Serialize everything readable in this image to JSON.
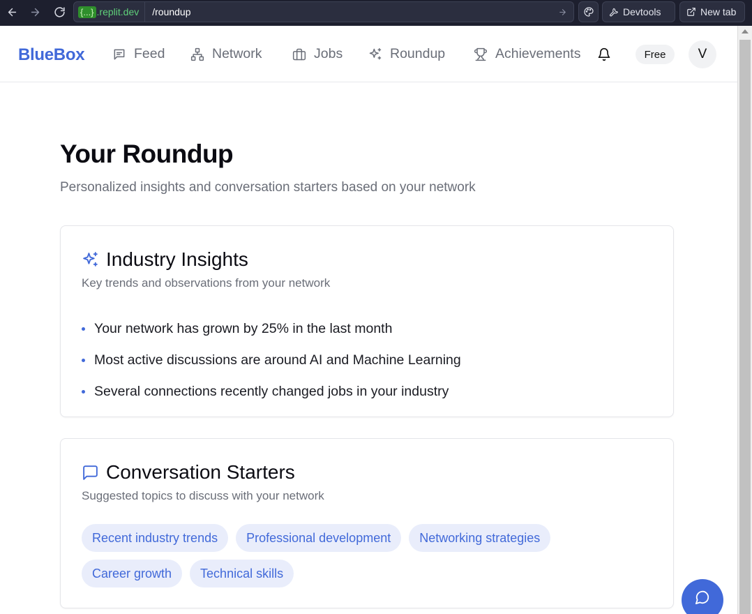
{
  "browser": {
    "url_domain_brace": "{...}",
    "url_domain": ".replit.dev",
    "url_path": "/roundup",
    "devtools_label": "Devtools",
    "new_tab_label": "New tab"
  },
  "header": {
    "brand": "BlueBox",
    "nav": [
      {
        "label": "Feed",
        "icon": "feed-icon"
      },
      {
        "label": "Network",
        "icon": "network-icon"
      },
      {
        "label": "Jobs",
        "icon": "briefcase-icon"
      },
      {
        "label": "Roundup",
        "icon": "sparkles-icon"
      },
      {
        "label": "Achievements",
        "icon": "trophy-icon"
      }
    ],
    "plan_badge": "Free",
    "avatar_initial": "V"
  },
  "page": {
    "title": "Your Roundup",
    "subtitle": "Personalized insights and conversation starters based on your network"
  },
  "insights": {
    "title": "Industry Insights",
    "description": "Key trends and observations from your network",
    "items": [
      "Your network has grown by 25% in the last month",
      "Most active discussions are around AI and Machine Learning",
      "Several connections recently changed jobs in your industry"
    ]
  },
  "starters": {
    "title": "Conversation Starters",
    "description": "Suggested topics to discuss with your network",
    "topics": [
      "Recent industry trends",
      "Professional development",
      "Networking strategies",
      "Career growth",
      "Technical skills"
    ]
  },
  "colors": {
    "accent": "#4169d9",
    "chip_bg": "#e9edfb",
    "chrome_bg": "#1d1f2e"
  }
}
